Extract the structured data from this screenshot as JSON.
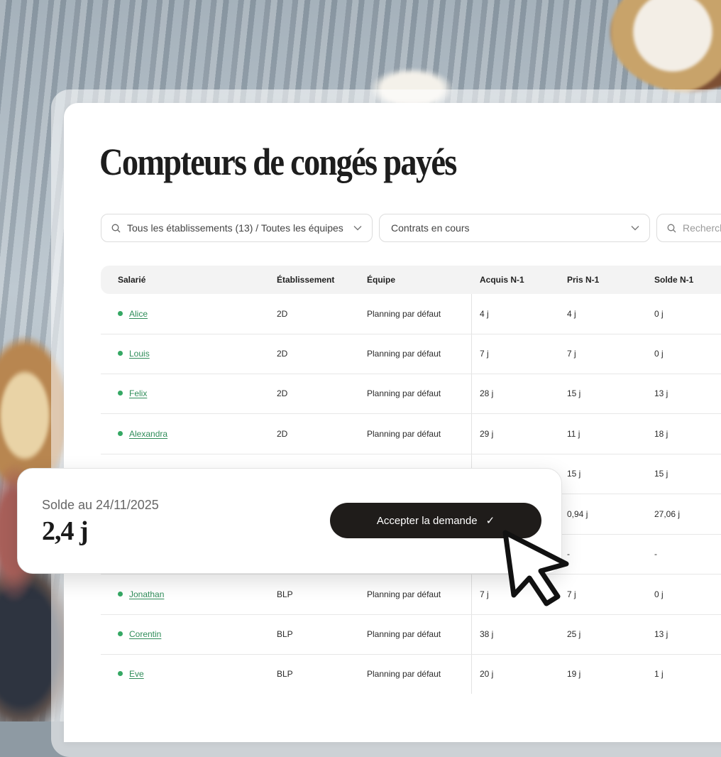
{
  "page": {
    "title": "Compteurs de congés payés"
  },
  "filters": {
    "establishments": "Tous les établissements (13) / Toutes les équipes",
    "contracts": "Contrats en cours",
    "search_placeholder": "Rechercher"
  },
  "table": {
    "columns": [
      "Salarié",
      "Établissement",
      "Équipe",
      "Acquis N-1",
      "Pris N-1",
      "Solde N-1"
    ],
    "rows": [
      {
        "name": "Alice",
        "etab": "2D",
        "team": "Planning par défaut",
        "acquis": "4 j",
        "pris": "4 j",
        "solde": "0 j"
      },
      {
        "name": "Louis",
        "etab": "2D",
        "team": "Planning par défaut",
        "acquis": "7 j",
        "pris": "7 j",
        "solde": "0 j"
      },
      {
        "name": "Felix",
        "etab": "2D",
        "team": "Planning par défaut",
        "acquis": "28 j",
        "pris": "15 j",
        "solde": "13 j"
      },
      {
        "name": "Alexandra",
        "etab": "2D",
        "team": "Planning par défaut",
        "acquis": "29 j",
        "pris": "11 j",
        "solde": "18 j"
      },
      {
        "name": "",
        "etab": "",
        "team": "",
        "acquis": "",
        "pris": "15 j",
        "solde": "15 j"
      },
      {
        "name": "",
        "etab": "",
        "team": "",
        "acquis": "",
        "pris": "0,94 j",
        "solde": "27,06 j"
      },
      {
        "name": "",
        "etab": "",
        "team": "",
        "acquis": "",
        "pris": "-",
        "solde": "-"
      },
      {
        "name": "Jonathan",
        "etab": "BLP",
        "team": "Planning par défaut",
        "acquis": "7 j",
        "pris": "7 j",
        "solde": "0 j"
      },
      {
        "name": "Corentin",
        "etab": "BLP",
        "team": "Planning par défaut",
        "acquis": "38 j",
        "pris": "25 j",
        "solde": "13 j"
      },
      {
        "name": "Eve",
        "etab": "BLP",
        "team": "Planning par défaut",
        "acquis": "20 j",
        "pris": "19 j",
        "solde": "1 j"
      }
    ]
  },
  "card": {
    "balance_label": "Solde au 24/11/2025",
    "balance_value": "2,4 j",
    "accept_label": "Accepter la demande",
    "accept_icon": "✓"
  },
  "colors": {
    "accent_green": "#35a864",
    "link_green": "#2f8d59",
    "button_dark": "#1f1c1a"
  },
  "icons": [
    "search-icon",
    "chevron-down-icon",
    "check-icon",
    "cursor-pointer-icon"
  ]
}
